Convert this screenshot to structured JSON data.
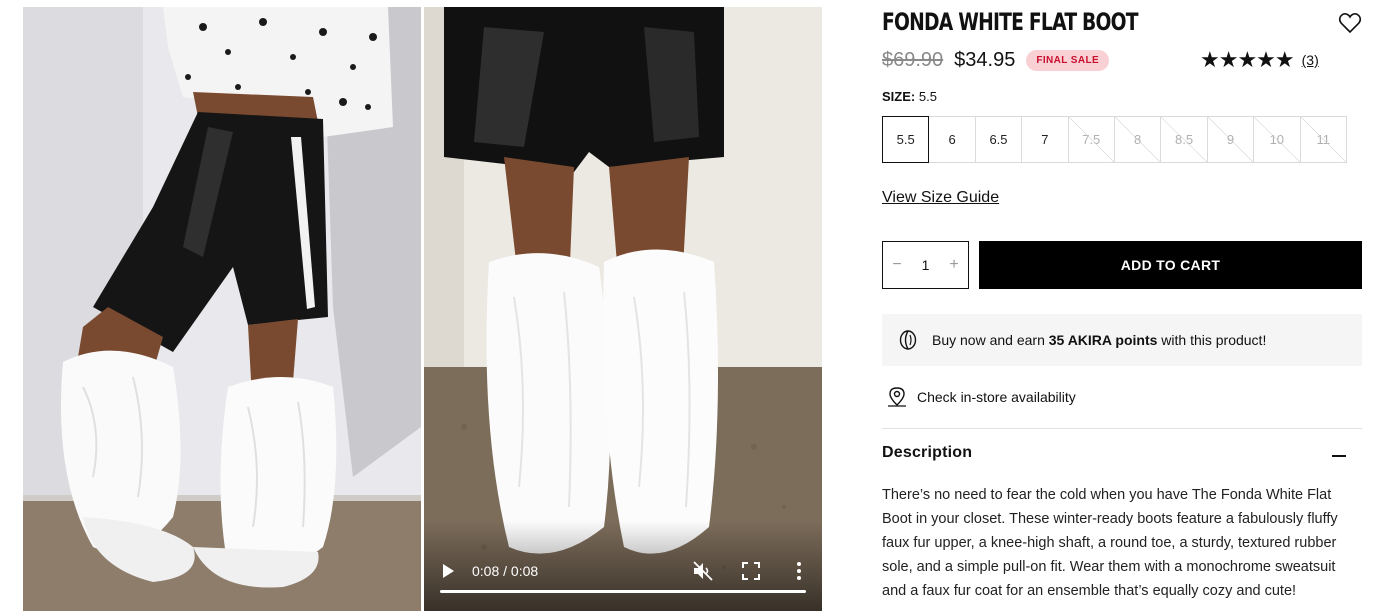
{
  "product": {
    "title": "FONDA WHITE FLAT BOOT",
    "old_price": "$69.90",
    "new_price": "$34.95",
    "sale_badge": "FINAL SALE",
    "rating_stars": 5,
    "rating_display": "★★★★★",
    "review_count": "(3)"
  },
  "video": {
    "time": "0:08 / 0:08",
    "progress": 1.0
  },
  "size": {
    "label": "SIZE:",
    "selected": "5.5",
    "options": [
      {
        "label": "5.5",
        "available": true
      },
      {
        "label": "6",
        "available": true
      },
      {
        "label": "6.5",
        "available": true
      },
      {
        "label": "7",
        "available": true
      },
      {
        "label": "7.5",
        "available": false
      },
      {
        "label": "8",
        "available": false
      },
      {
        "label": "8.5",
        "available": false
      },
      {
        "label": "9",
        "available": false
      },
      {
        "label": "10",
        "available": false
      },
      {
        "label": "11",
        "available": false
      }
    ],
    "guide_link": "View Size Guide"
  },
  "cart": {
    "minus": "−",
    "quantity": "1",
    "plus": "+",
    "add_label": "ADD TO CART"
  },
  "points": {
    "prefix": "Buy now and earn ",
    "amount": "35 AKIRA points",
    "suffix": " with this product!"
  },
  "store": {
    "label": "Check in-store availability"
  },
  "description": {
    "title": "Description",
    "body": "There’s no need to fear the cold when you have The Fonda White Flat Boot in your closet. These winter-ready boots feature a fabulously fluffy faux fur upper, a knee-high shaft, a round toe, a sturdy, textured rubber sole, and a simple pull-on fit. Wear them with a monochrome sweatsuit and a faux fur coat for an ensemble that’s equally cozy and cute!"
  },
  "colors": {
    "sale_bg": "#f9d0d4",
    "sale_text": "#c8102e",
    "button_bg": "#000000"
  }
}
